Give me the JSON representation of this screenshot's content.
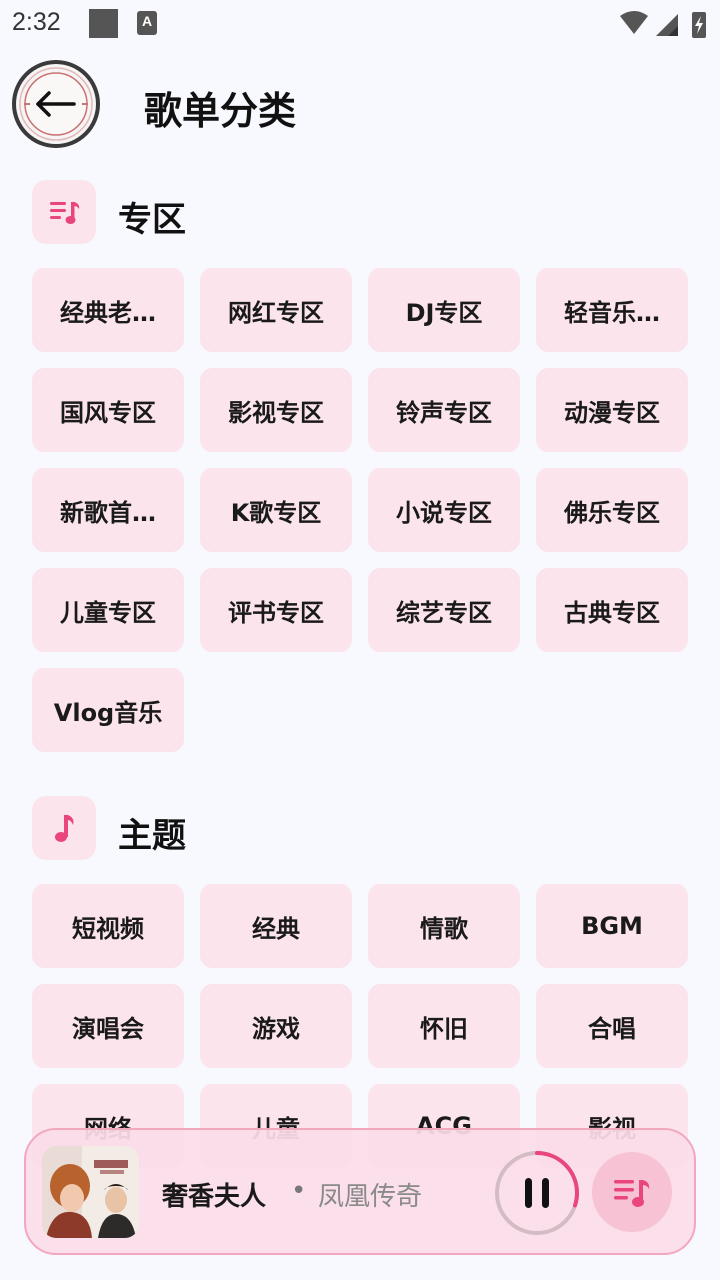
{
  "status_bar": {
    "time": "2:32",
    "notification_letter": "A"
  },
  "header": {
    "title": "歌单分类"
  },
  "sections": [
    {
      "title": "专区",
      "icon": "playlist-icon",
      "items": [
        "经典老…",
        "网红专区",
        "DJ专区",
        "轻音乐…",
        "国风专区",
        "影视专区",
        "铃声专区",
        "动漫专区",
        "新歌首…",
        "K歌专区",
        "小说专区",
        "佛乐专区",
        "儿童专区",
        "评书专区",
        "综艺专区",
        "古典专区",
        "Vlog音乐"
      ]
    },
    {
      "title": "主题",
      "icon": "music-note-icon",
      "items": [
        "短视频",
        "经典",
        "情歌",
        "BGM",
        "演唱会",
        "游戏",
        "怀旧",
        "合唱",
        "网络",
        "儿童",
        "ACG",
        "影视"
      ]
    }
  ],
  "player": {
    "song": "奢香夫人",
    "separator": "•",
    "artist": "凤凰传奇",
    "state": "playing",
    "progress": 0.3
  },
  "colors": {
    "accent": "#e8467c",
    "chip_bg": "#fce4ec",
    "page_bg": "#f8f9fe"
  }
}
